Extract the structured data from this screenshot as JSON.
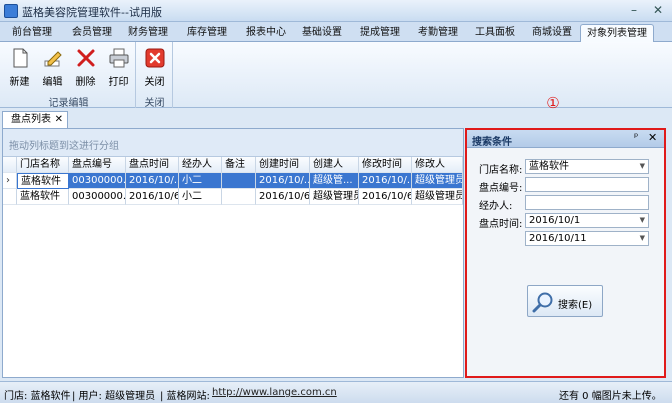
{
  "window": {
    "title": "蓝格美容院管理软件--试用版",
    "minimize": "–",
    "close": "✕"
  },
  "menu_tabs": [
    "前台管理",
    "会员管理",
    "财务管理",
    "库存管理",
    "报表中心",
    "基础设置",
    "提成管理",
    "考勤管理",
    "工具面板",
    "商城设置",
    "对象列表管理"
  ],
  "active_menu_tab": "对象列表管理",
  "ribbon": {
    "record_group": {
      "label": "记录编辑",
      "buttons": [
        "新建",
        "编辑",
        "删除",
        "打印"
      ]
    },
    "close_group": {
      "label": "关闭",
      "buttons": [
        "关闭"
      ]
    }
  },
  "doc_tab": {
    "label": "盘点列表",
    "close": "✕"
  },
  "grid": {
    "group_hint": "拖动列标题到这进行分组",
    "columns": [
      "门店名称",
      "盘点编号",
      "盘点时间",
      "经办人",
      "备注",
      "创建时间",
      "创建人",
      "修改时间",
      "修改人"
    ],
    "rows": [
      [
        "蓝格软件",
        "00300000...",
        "2016/10/...",
        "小二",
        "",
        "2016/10/...",
        "超级管...",
        "2016/10/...",
        "超级管理员"
      ],
      [
        "蓝格软件",
        "00300000...",
        "2016/10/6",
        "小二",
        "",
        "2016/10/6",
        "超级管理员",
        "2016/10/6",
        "超级管理员"
      ]
    ],
    "selected_row": 0,
    "row_indicator": "›"
  },
  "search_panel": {
    "title": "搜索条件",
    "pin": "ᵖ",
    "close": "✕",
    "store_label": "门店名称:",
    "store_value": "蓝格软件",
    "number_label": "盘点编号:",
    "number_value": "",
    "handler_label": "经办人:",
    "handler_value": "",
    "time_label": "盘点时间:",
    "time_from": "2016/10/1",
    "time_to": "2016/10/11",
    "search_button": "搜索(E)",
    "annotation": "①"
  },
  "status": {
    "store": "门店: 蓝格软件",
    "user": "| 用户: 超级管理员",
    "website_label": "| 蓝格网站:",
    "website": "http://www.lange.com.cn",
    "images": "还有 0 幅图片未上传。"
  },
  "colors": {
    "accent": "#3a76d0",
    "highlight": "#e01a1a"
  }
}
